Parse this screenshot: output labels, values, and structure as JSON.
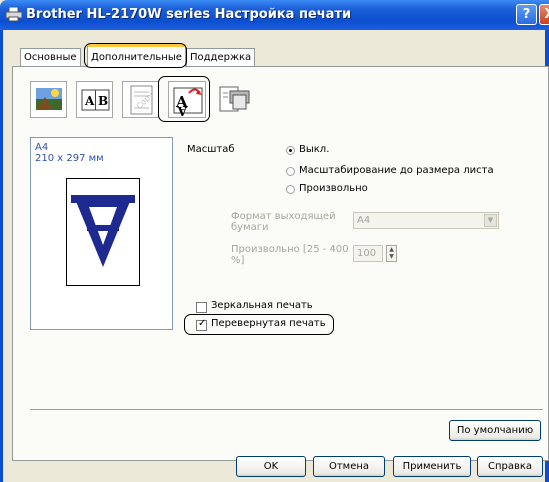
{
  "window": {
    "title": "Brother HL-2170W series Настройка печати",
    "help_label": "?",
    "close_label": "X"
  },
  "tabs": [
    {
      "label": "Основные"
    },
    {
      "label": "Дополнительные"
    },
    {
      "label": "Поддержка"
    }
  ],
  "toolbar": {
    "icons": [
      "quality-icon",
      "multiple-page-icon",
      "watermark-icon",
      "page-setting-icon",
      "device-options-icon"
    ],
    "ab_text": "A|B",
    "av_text": "A",
    "copy_text": "Copy"
  },
  "preview": {
    "paper": "A4",
    "size": "210 x 297 мм",
    "glyph": "A"
  },
  "scaling": {
    "label": "Масштаб",
    "options": [
      {
        "label": "Выкл.",
        "selected": true
      },
      {
        "label": "Масштабирование до размера листа",
        "selected": false
      },
      {
        "label": "Произвольно",
        "selected": false
      }
    ],
    "output_paper_label": "Формат выходящей бумаги",
    "output_paper_value": "A4",
    "free_label": "Произвольно [25 - 400 %]",
    "free_value": "100"
  },
  "options": {
    "mirror_print": {
      "label": "Зеркальная печать",
      "checked": false
    },
    "reverse_print": {
      "label": "Перевернутая печать",
      "checked": true
    }
  },
  "buttons": {
    "default": "По умолчанию",
    "ok": "OK",
    "cancel": "Отмена",
    "apply": "Применить",
    "help": "Справка"
  }
}
